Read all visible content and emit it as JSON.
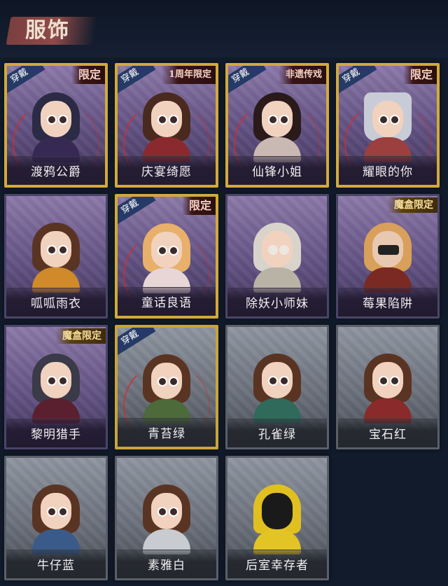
{
  "header": {
    "title": "服饰"
  },
  "badges": {
    "wear": "穿戴"
  },
  "cards": [
    {
      "name": "渡鸦公爵",
      "worn": true,
      "tag": "限定",
      "style": "gold"
    },
    {
      "name": "庆宴绮愿",
      "worn": true,
      "tag": "1周年限定",
      "style": "gold"
    },
    {
      "name": "仙锋小姐",
      "worn": true,
      "tag": "非遗传戏",
      "style": "gold"
    },
    {
      "name": "耀眼的你",
      "worn": true,
      "tag": "限定",
      "style": "gold"
    },
    {
      "name": "呱呱雨衣",
      "worn": false,
      "tag": "",
      "style": "purple"
    },
    {
      "name": "童话良语",
      "worn": true,
      "tag": "限定",
      "style": "gold"
    },
    {
      "name": "除妖小师妹",
      "worn": false,
      "tag": "",
      "style": "purple"
    },
    {
      "name": "莓果陷阱",
      "worn": false,
      "tag": "魔盒限定",
      "style": "purple"
    },
    {
      "name": "黎明猎手",
      "worn": false,
      "tag": "魔盒限定",
      "style": "purple"
    },
    {
      "name": "青苔绿",
      "worn": true,
      "tag": "",
      "style": "gold-gray"
    },
    {
      "name": "孔雀绿",
      "worn": false,
      "tag": "",
      "style": "gray"
    },
    {
      "name": "宝石红",
      "worn": false,
      "tag": "",
      "style": "gray"
    },
    {
      "name": "牛仔蓝",
      "worn": false,
      "tag": "",
      "style": "gray"
    },
    {
      "name": "素雅白",
      "worn": false,
      "tag": "",
      "style": "gray"
    },
    {
      "name": "后室幸存者",
      "worn": false,
      "tag": "",
      "style": "gray"
    }
  ],
  "colors": {
    "background": "#121b2b",
    "title_brush": "#8d4a48",
    "gold_border": "#d2a93c",
    "purple_card": "#6a5a8c",
    "gray_card": "#6a707b",
    "wear_badge": "#253a66"
  }
}
